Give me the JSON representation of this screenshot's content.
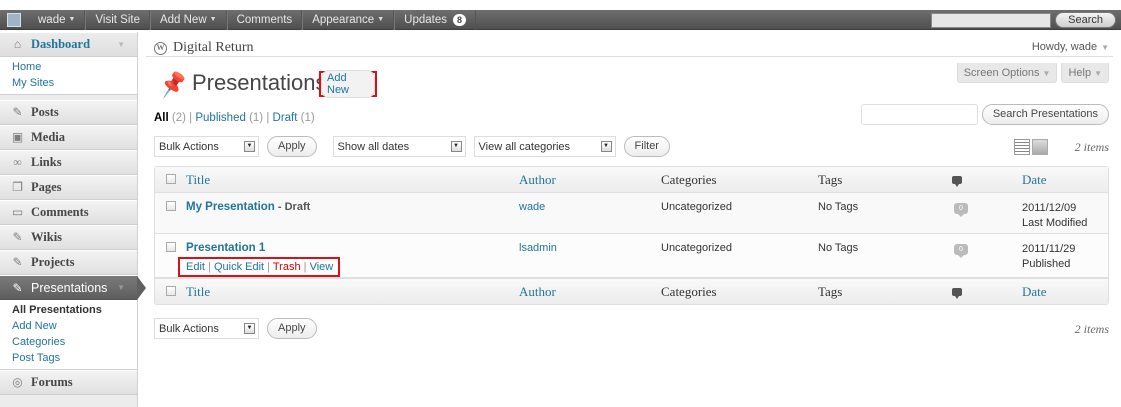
{
  "adminbar": {
    "user": "wade",
    "items": [
      "Visit Site",
      "Add New",
      "Comments",
      "Appearance",
      "Updates"
    ],
    "updates_count": "8",
    "search_button": "Search"
  },
  "sidebar": {
    "dashboard": "Dashboard",
    "dashboard_subs": [
      "Home",
      "My Sites"
    ],
    "menus": [
      "Posts",
      "Media",
      "Links",
      "Pages",
      "Comments",
      "Wikis",
      "Projects"
    ],
    "active": "Presentations",
    "active_subs": [
      "All Presentations",
      "Add New",
      "Categories",
      "Post Tags"
    ],
    "after": "Forums"
  },
  "header": {
    "site_name": "Digital Return",
    "howdy": "Howdy, wade",
    "screen_options": "Screen Options",
    "help": "Help"
  },
  "page": {
    "title": "Presentations",
    "add_new": "Add New"
  },
  "filters": {
    "all": "All",
    "all_count": "(2)",
    "published": "Published",
    "published_count": "(1)",
    "draft": "Draft",
    "draft_count": "(1)",
    "search_button": "Search Presentations"
  },
  "tablenav": {
    "bulk_actions": "Bulk Actions",
    "apply": "Apply",
    "dates": "Show all dates",
    "categories": "View all categories",
    "filter": "Filter",
    "items": "2 items"
  },
  "table": {
    "columns": {
      "title": "Title",
      "author": "Author",
      "categories": "Categories",
      "tags": "Tags",
      "date": "Date"
    },
    "rows": [
      {
        "title": "My Presentation",
        "state": "- Draft",
        "author": "wade",
        "categories": "Uncategorized",
        "tags": "No Tags",
        "comments": "0",
        "date": "2011/12/09",
        "status": "Last Modified"
      },
      {
        "title": "Presentation 1",
        "author": "lsadmin",
        "categories": "Uncategorized",
        "tags": "No Tags",
        "comments": "0",
        "date": "2011/11/29",
        "status": "Published",
        "actions": [
          "Edit",
          "Quick Edit",
          "Trash",
          "View"
        ]
      }
    ]
  }
}
